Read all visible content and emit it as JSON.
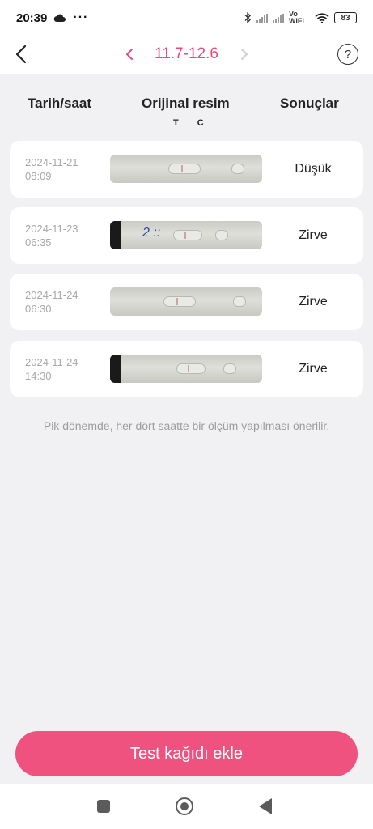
{
  "status_bar": {
    "time": "20:39",
    "network_label": "Vo WiFi",
    "battery": "83"
  },
  "header": {
    "period": "11.7-12.6"
  },
  "columns": {
    "date": "Tarih/saat",
    "image": "Orijinal resim",
    "image_sub": "T C",
    "result": "Sonuçlar"
  },
  "rows": [
    {
      "date": "2024-11-21",
      "time": "08:09",
      "result": "Düşük"
    },
    {
      "date": "2024-11-23",
      "time": "06:35",
      "result": "Zirve",
      "strip_mark": "2 ::"
    },
    {
      "date": "2024-11-24",
      "time": "06:30",
      "result": "Zirve"
    },
    {
      "date": "2024-11-24",
      "time": "14:30",
      "result": "Zirve"
    }
  ],
  "hint": "Pik dönemde, her dört saatte bir ölçüm yapılması önerilir.",
  "add_button": "Test kağıdı ekle",
  "colors": {
    "accent": "#e94a7c",
    "button": "#f0527f",
    "background": "#f1f1f4"
  },
  "icons": {
    "back": "chevron-left-icon",
    "prev": "chevron-left-icon",
    "next": "chevron-right-icon",
    "help": "question-circle-icon"
  }
}
